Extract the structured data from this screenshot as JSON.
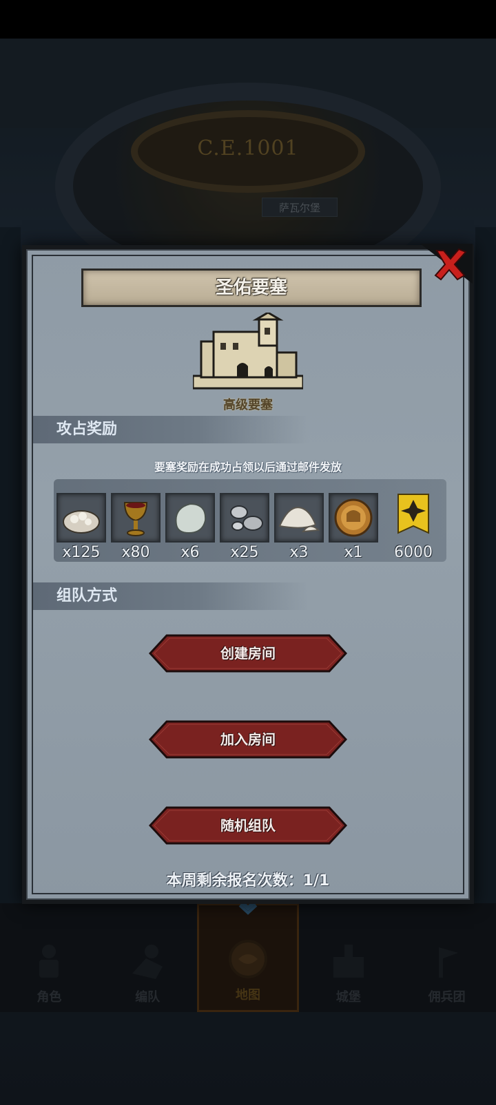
{
  "background": {
    "year": "C.E.1001",
    "place_label": "萨瓦尔堡"
  },
  "dialog": {
    "title": "圣佑要塞",
    "fortress_type": "高级要塞",
    "close_icon": "close-x-icon",
    "rewards_section": {
      "header": "攻占奖励",
      "note": "要塞奖励在成功占领以后通过邮件发放",
      "items": [
        {
          "icon": "gem-pile-icon",
          "qty": "x125"
        },
        {
          "icon": "goblet-icon",
          "qty": "x80"
        },
        {
          "icon": "stone-icon",
          "qty": "x6"
        },
        {
          "icon": "silver-ore-icon",
          "qty": "x25"
        },
        {
          "icon": "salt-pile-icon",
          "qty": "x3"
        },
        {
          "icon": "knight-medal-icon",
          "qty": "x1"
        },
        {
          "icon": "rank-badge-icon",
          "qty": "6000"
        }
      ]
    },
    "team_section": {
      "header": "组队方式"
    },
    "buttons": {
      "create_room": "创建房间",
      "join_room": "加入房间",
      "random_team": "随机组队"
    },
    "signup_remaining": "本周剩余报名次数：1/1"
  },
  "bottom_nav": {
    "items": [
      {
        "label": "角色",
        "icon": "character-icon"
      },
      {
        "label": "编队",
        "icon": "formation-icon"
      },
      {
        "label": "地图",
        "icon": "map-icon",
        "active": true
      },
      {
        "label": "城堡",
        "icon": "castle-icon"
      },
      {
        "label": "佣兵团",
        "icon": "mercenary-icon"
      }
    ]
  },
  "colors": {
    "button_red": "#7a2220",
    "dialog_bg": "#919da8",
    "close_red": "#c8201c"
  }
}
